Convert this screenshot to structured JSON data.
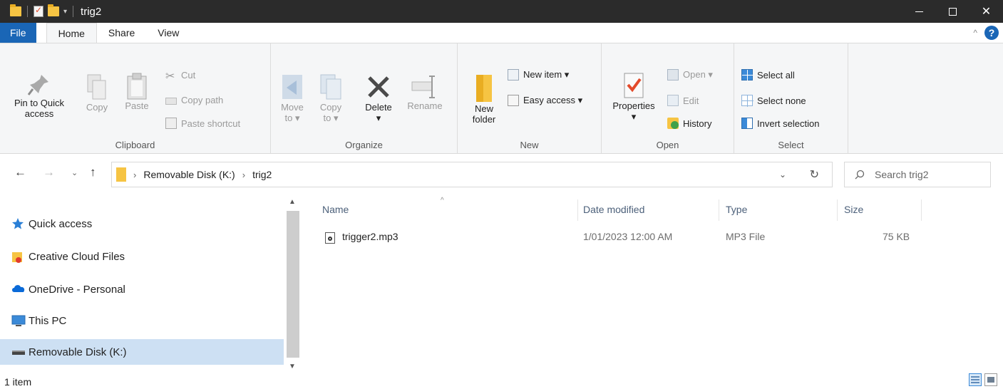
{
  "window": {
    "title": "trig2",
    "controls": {
      "minimize": "minimize",
      "maximize": "maximize",
      "close": "✕"
    }
  },
  "tabs": {
    "file": "File",
    "home": "Home",
    "share": "Share",
    "view": "View"
  },
  "ribbon": {
    "clipboard": {
      "label": "Clipboard",
      "pin": "Pin to Quick\naccess",
      "copy": "Copy",
      "paste": "Paste",
      "cut": "Cut",
      "copy_path": "Copy path",
      "paste_shortcut": "Paste shortcut"
    },
    "organize": {
      "label": "Organize",
      "move_to": "Move\nto ▾",
      "copy_to": "Copy\nto ▾",
      "delete": "Delete\n▾",
      "rename": "Rename"
    },
    "new": {
      "label": "New",
      "new_folder": "New\nfolder",
      "new_item": "New item ▾",
      "easy_access": "Easy access ▾"
    },
    "open": {
      "label": "Open",
      "properties": "Properties\n▾",
      "open": "Open ▾",
      "edit": "Edit",
      "history": "History"
    },
    "select": {
      "label": "Select",
      "select_all": "Select all",
      "select_none": "Select none",
      "invert_selection": "Invert selection"
    }
  },
  "address": {
    "crumbs": [
      "Removable Disk (K:)",
      "trig2"
    ],
    "search_placeholder": "Search trig2"
  },
  "nav": {
    "items": [
      {
        "label": "Quick access",
        "icon": "star-icon"
      },
      {
        "label": "Creative Cloud Files",
        "icon": "creative-cloud-folder-icon"
      },
      {
        "label": "OneDrive - Personal",
        "icon": "onedrive-cloud-icon"
      },
      {
        "label": "This PC",
        "icon": "computer-icon"
      },
      {
        "label": "Removable Disk (K:)",
        "icon": "removable-drive-icon",
        "selected": true
      }
    ]
  },
  "filelist": {
    "columns": {
      "name": "Name",
      "date": "Date modified",
      "type": "Type",
      "size": "Size"
    },
    "rows": [
      {
        "name": "trigger2.mp3",
        "date": "1/01/2023 12:00 AM",
        "type": "MP3 File",
        "size": "75 KB",
        "icon": "audio-file-icon"
      }
    ]
  },
  "status": {
    "count": "1 item"
  },
  "colors": {
    "file_tab": "#1a66b6",
    "titlebar": "#2b2b2b",
    "selected_nav": "#cde0f3",
    "folder": "#f6c443"
  }
}
